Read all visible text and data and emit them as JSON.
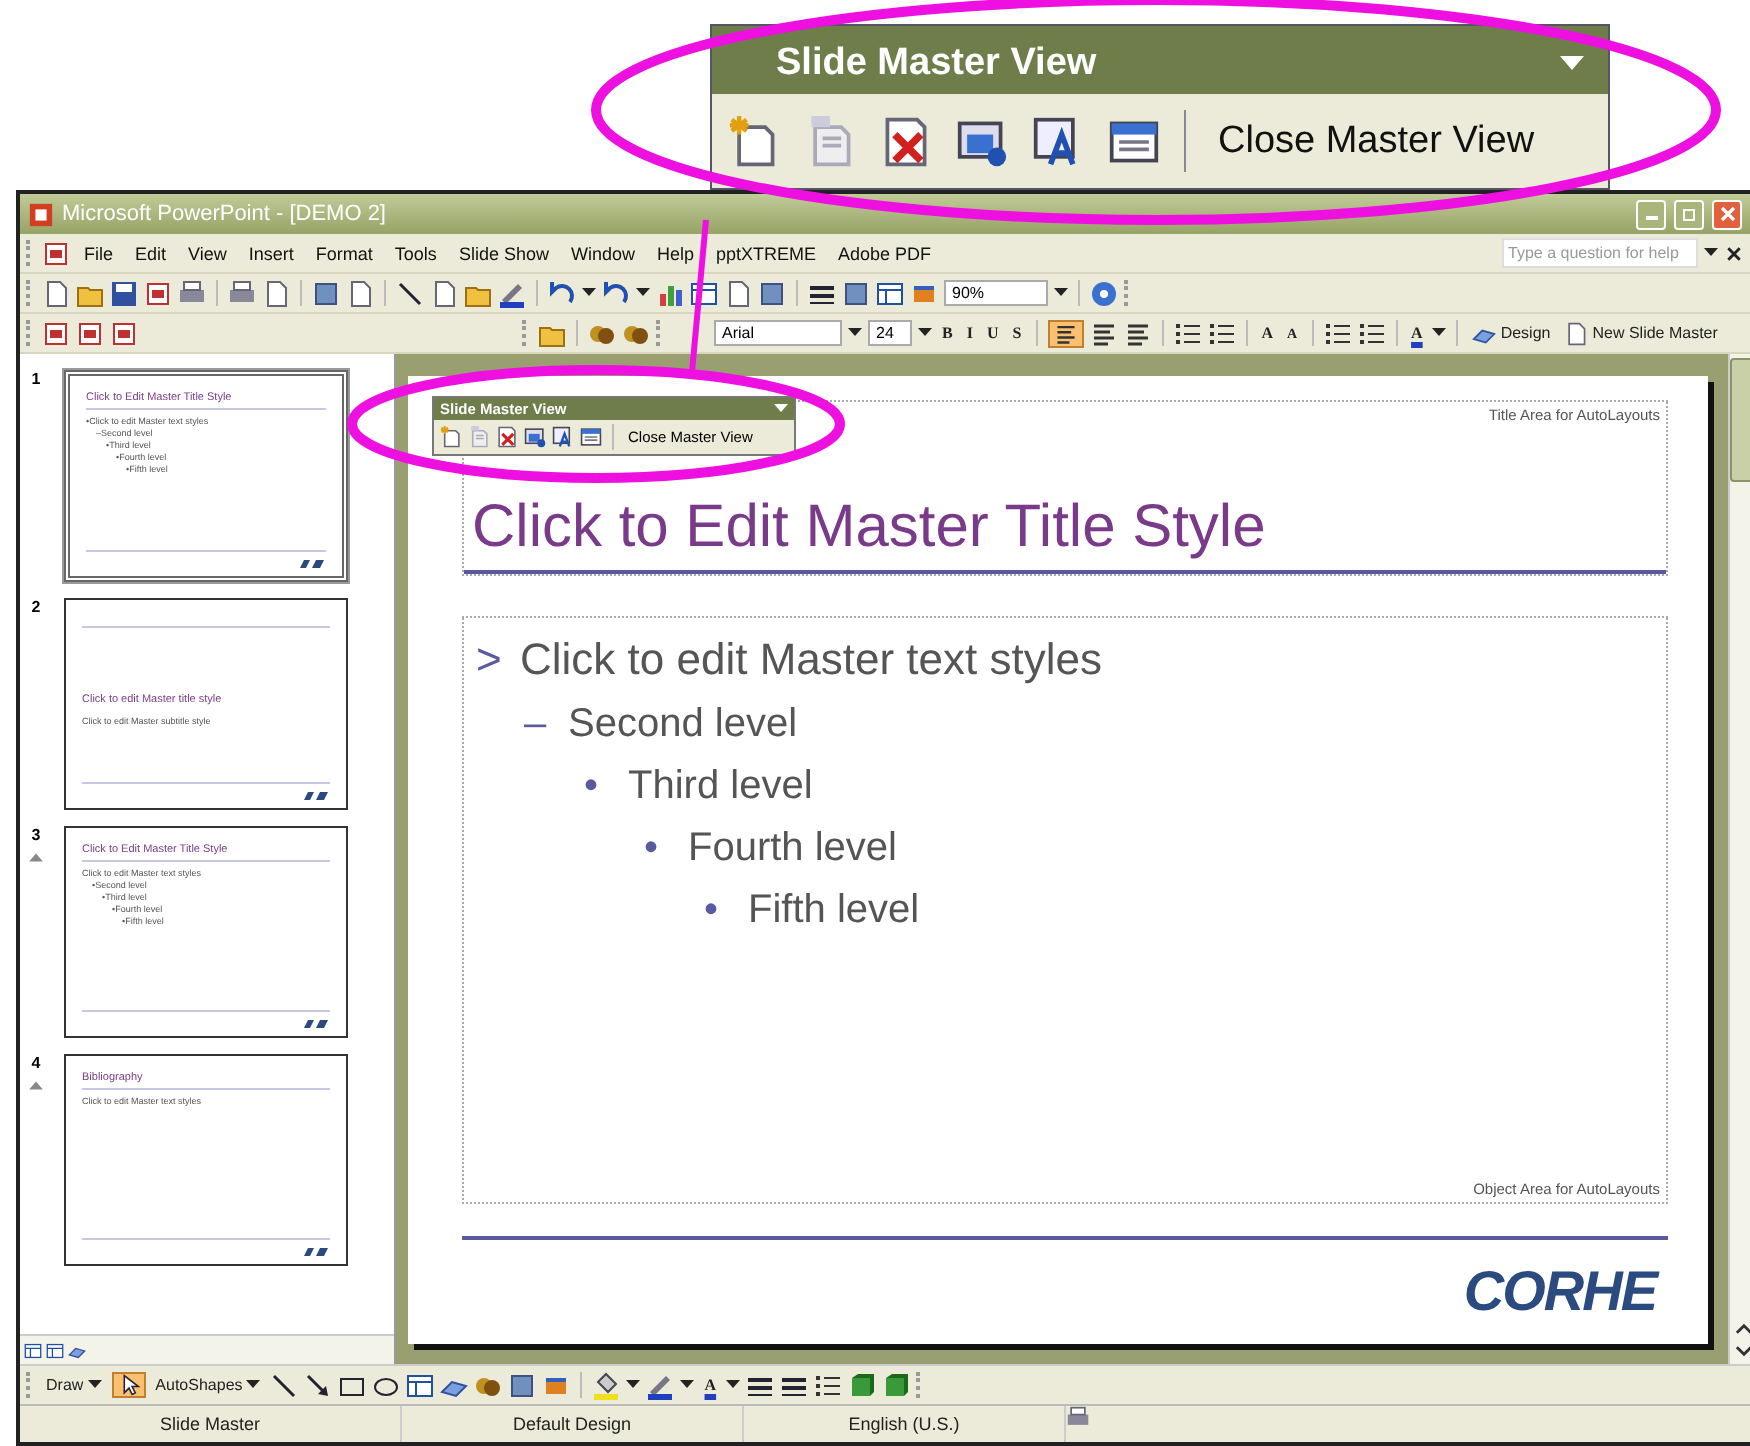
{
  "callout": {
    "title": "Slide Master View",
    "close_label": "Close Master View"
  },
  "window": {
    "title": "Microsoft PowerPoint - [DEMO 2]"
  },
  "menu": [
    {
      "label": "File"
    },
    {
      "label": "Edit"
    },
    {
      "label": "View"
    },
    {
      "label": "Insert"
    },
    {
      "label": "Format"
    },
    {
      "label": "Tools"
    },
    {
      "label": "Slide Show"
    },
    {
      "label": "Window"
    },
    {
      "label": "Help"
    },
    {
      "label": "pptXTREME"
    },
    {
      "label": "Adobe PDF"
    }
  ],
  "help_search": {
    "placeholder": "Type a question for help"
  },
  "standard_toolbar": {
    "zoom": "90%"
  },
  "formatting_toolbar": {
    "font": "Arial",
    "size": "24",
    "styles": [
      "B",
      "I",
      "U",
      "S"
    ],
    "grow": "A",
    "shrink": "A",
    "font_color": "A",
    "design": "Design",
    "new_master": "New Slide Master"
  },
  "slides": [
    {
      "number": "1",
      "selected": true,
      "animated": false,
      "title": "Click to Edit Master Title Style",
      "body": [
        {
          "bullet": "•",
          "text": "Click to edit Master text styles",
          "children": [
            {
              "bullet": "–",
              "text": "Second level",
              "children": [
                {
                  "bullet": "•",
                  "text": "Third level",
                  "children": [
                    {
                      "bullet": "•",
                      "text": "Fourth level",
                      "children": [
                        {
                          "bullet": "•",
                          "text": "Fifth level"
                        }
                      ]
                    }
                  ]
                }
              ]
            }
          ]
        }
      ]
    },
    {
      "number": "2",
      "selected": false,
      "animated": false,
      "title": "Click to edit Master title style",
      "body": [
        {
          "text": "Click to edit Master subtitle style"
        }
      ]
    },
    {
      "number": "3",
      "selected": false,
      "animated": true,
      "title": "Click to Edit Master Title Style",
      "body": [
        {
          "text": "Click to edit Master text styles",
          "children": [
            {
              "bullet": "•",
              "text": "Second level",
              "children": [
                {
                  "bullet": "•",
                  "text": "Third level",
                  "children": [
                    {
                      "bullet": "•",
                      "text": "Fourth level",
                      "children": [
                        {
                          "bullet": "•",
                          "text": "Fifth level"
                        }
                      ]
                    }
                  ]
                }
              ]
            }
          ]
        }
      ]
    },
    {
      "number": "4",
      "selected": false,
      "animated": true,
      "title": "Bibliography",
      "body": [
        {
          "text": "Click to edit Master text styles"
        }
      ]
    }
  ],
  "master_toolbar": {
    "title": "Slide Master View",
    "close_label": "Close Master View"
  },
  "slide": {
    "title_area_label": "Title Area for AutoLayouts",
    "title": "Click to Edit Master Title Style",
    "body": [
      {
        "bullet": ">",
        "text": "Click to edit Master text styles",
        "children": [
          {
            "bullet": "–",
            "text": "Second level",
            "children": [
              {
                "bullet": "•",
                "text": "Third level",
                "children": [
                  {
                    "bullet": "•",
                    "text": "Fourth level",
                    "children": [
                      {
                        "bullet": "•",
                        "text": "Fifth level"
                      }
                    ]
                  }
                ]
              }
            ]
          }
        ]
      }
    ],
    "object_area_label": "Object Area for AutoLayouts",
    "logo": "CORHE"
  },
  "drawing_toolbar": {
    "draw": "Draw",
    "autoshapes": "AutoShapes",
    "font_color": "A"
  },
  "status_bar": [
    "Slide Master",
    "Default Design",
    "English (U.S.)"
  ]
}
